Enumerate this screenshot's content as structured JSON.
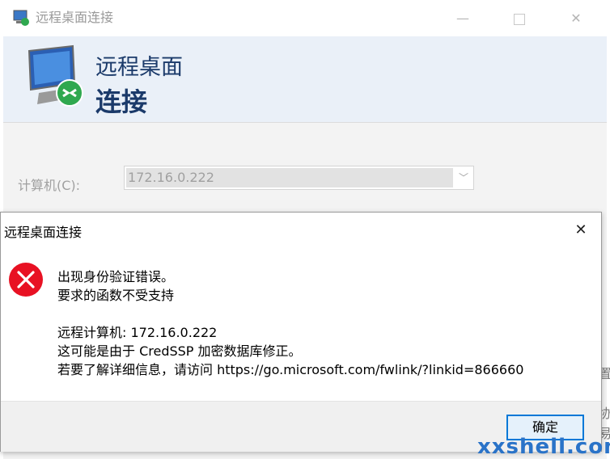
{
  "background_window": {
    "title": "远程桌面连接",
    "minimize": "—",
    "close": "✕",
    "banner_line1": "远程桌面",
    "banner_line2": "连接",
    "computer_label": "计算机(C):",
    "computer_value": "172.16.0.222",
    "dropdown_icon": "chevron-down-icon",
    "right_edge_chars": [
      "置",
      "协",
      "易"
    ]
  },
  "dialog": {
    "title": "远程桌面连接",
    "close": "✕",
    "icon": "error-icon",
    "message_lines": [
      "出现身份验证错误。",
      "要求的函数不受支持",
      "远程计算机: 172.16.0.222",
      "这可能是由于 CredSSP 加密数据库修正。",
      "若要了解详细信息，请访问 https://go.microsoft.com/fwlink/?linkid=866660"
    ],
    "ok_label": "确定"
  },
  "watermark": "xxshell.com",
  "colors": {
    "error_red": "#e81123",
    "accent_blue": "#0078d7",
    "banner_text": "#1b3a6a",
    "banner_bg": "#eaf0f8"
  }
}
